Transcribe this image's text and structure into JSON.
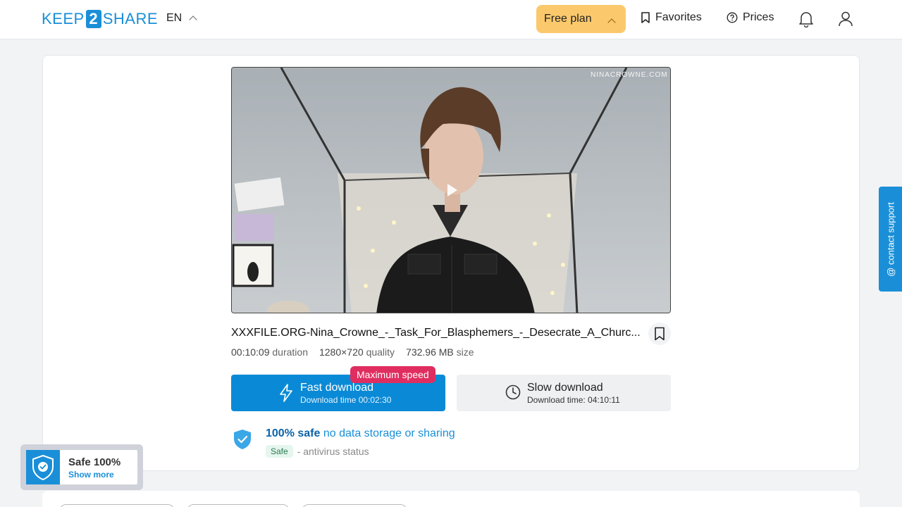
{
  "header": {
    "logo": {
      "pre": "KEEP",
      "num": "2",
      "post": "SHARE"
    },
    "language": "EN",
    "plan_label": "Free plan",
    "favorites_label": "Favorites",
    "prices_label": "Prices"
  },
  "video": {
    "watermark": "NINACROWNE.COM"
  },
  "file": {
    "title": "XXXFILE.ORG-Nina_Crowne_-_Task_For_Blasphemers_-_Desecrate_A_Churc...",
    "duration_value": "00:10:09",
    "duration_label": "duration",
    "quality_value": "1280×720",
    "quality_label": "quality",
    "size_value": "732.96 MB",
    "size_label": "size"
  },
  "download": {
    "max_speed_badge": "Maximum speed",
    "fast_label": "Fast download",
    "fast_time": "Download time 00:02:30",
    "slow_label": "Slow download",
    "slow_time": "Download time: 04:10:11"
  },
  "safety": {
    "bold": "100% safe",
    "text": "no data storage or sharing",
    "status_pill": "Safe",
    "status_text": "- antivirus status"
  },
  "support_label": "@ contact support",
  "badge": {
    "title": "Safe 100%",
    "link": "Show more"
  },
  "colors": {
    "accent": "#1a8fd8",
    "plan": "#fbc96c",
    "max_speed": "#e02d5f"
  }
}
